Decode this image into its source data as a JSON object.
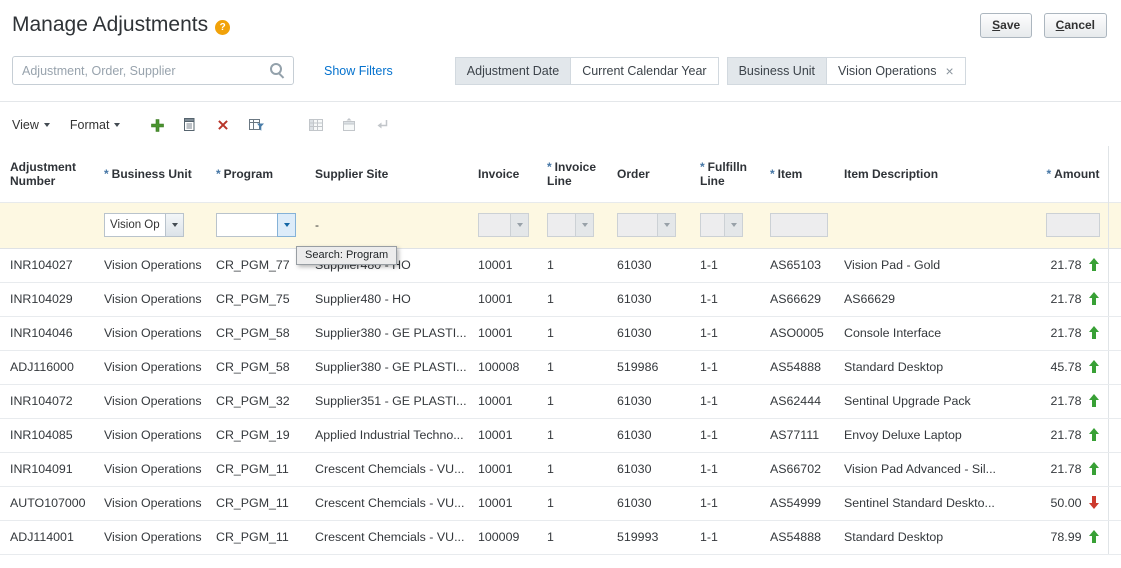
{
  "page": {
    "title": "Manage Adjustments",
    "help_glyph": "?"
  },
  "actions": {
    "save": "Save",
    "cancel": "Cancel"
  },
  "search": {
    "placeholder": "Adjustment, Order, Supplier",
    "show_filters": "Show Filters",
    "close_glyph": "×",
    "tokens": [
      {
        "label": "Adjustment Date",
        "value": "Current Calendar Year",
        "removable": false
      },
      {
        "label": "Business Unit",
        "value": "Vision Operations",
        "removable": true
      }
    ]
  },
  "toolbar": {
    "view": "View",
    "format": "Format"
  },
  "tooltip": {
    "text": "Search: Program"
  },
  "table": {
    "columns": [
      {
        "key": "adjustment_number",
        "label": "Adjustment Number",
        "required": false
      },
      {
        "key": "business_unit",
        "label": "Business Unit",
        "required": true
      },
      {
        "key": "program",
        "label": "Program",
        "required": true
      },
      {
        "key": "supplier_site",
        "label": "Supplier Site",
        "required": false
      },
      {
        "key": "invoice",
        "label": "Invoice",
        "required": false
      },
      {
        "key": "invoice_line",
        "label": "Invoice Line",
        "required": true
      },
      {
        "key": "order",
        "label": "Order",
        "required": false
      },
      {
        "key": "fulfill_line",
        "label": "Fulfilln Line",
        "required": true
      },
      {
        "key": "item",
        "label": "Item",
        "required": true
      },
      {
        "key": "item_description",
        "label": "Item Description",
        "required": false
      },
      {
        "key": "amount",
        "label": "Amount",
        "required": true,
        "align": "right"
      }
    ],
    "filter_row": {
      "business_unit": "Vision Oper",
      "program": "",
      "supplier_site": "-",
      "invoice": "",
      "invoice_line": "",
      "order": "",
      "fulfill_line": "",
      "item": "",
      "amount": ""
    },
    "rows": [
      {
        "adjustment_number": "INR104027",
        "business_unit": "Vision Operations",
        "program": "CR_PGM_77",
        "supplier_site": "Supplier480 - HO",
        "invoice": "10001",
        "invoice_line": "1",
        "order": "61030",
        "fulfill_line": "1-1",
        "item": "AS65103",
        "item_description": "Vision Pad - Gold",
        "amount": "21.78",
        "trend": "up"
      },
      {
        "adjustment_number": "INR104029",
        "business_unit": "Vision Operations",
        "program": "CR_PGM_75",
        "supplier_site": "Supplier480 - HO",
        "invoice": "10001",
        "invoice_line": "1",
        "order": "61030",
        "fulfill_line": "1-1",
        "item": "AS66629",
        "item_description": "AS66629",
        "amount": "21.78",
        "trend": "up"
      },
      {
        "adjustment_number": "INR104046",
        "business_unit": "Vision Operations",
        "program": "CR_PGM_58",
        "supplier_site": "Supplier380 - GE PLASTI...",
        "invoice": "10001",
        "invoice_line": "1",
        "order": "61030",
        "fulfill_line": "1-1",
        "item": "ASO0005",
        "item_description": "Console Interface",
        "amount": "21.78",
        "trend": "up"
      },
      {
        "adjustment_number": "ADJ116000",
        "business_unit": "Vision Operations",
        "program": "CR_PGM_58",
        "supplier_site": "Supplier380 - GE PLASTI...",
        "invoice": "100008",
        "invoice_line": "1",
        "order": "519986",
        "fulfill_line": "1-1",
        "item": "AS54888",
        "item_description": "Standard Desktop",
        "amount": "45.78",
        "trend": "up"
      },
      {
        "adjustment_number": "INR104072",
        "business_unit": "Vision Operations",
        "program": "CR_PGM_32",
        "supplier_site": "Supplier351 - GE PLASTI...",
        "invoice": "10001",
        "invoice_line": "1",
        "order": "61030",
        "fulfill_line": "1-1",
        "item": "AS62444",
        "item_description": "Sentinal Upgrade Pack",
        "amount": "21.78",
        "trend": "up"
      },
      {
        "adjustment_number": "INR104085",
        "business_unit": "Vision Operations",
        "program": "CR_PGM_19",
        "supplier_site": "Applied Industrial Techno...",
        "invoice": "10001",
        "invoice_line": "1",
        "order": "61030",
        "fulfill_line": "1-1",
        "item": "AS77111",
        "item_description": "Envoy Deluxe Laptop",
        "amount": "21.78",
        "trend": "up"
      },
      {
        "adjustment_number": "INR104091",
        "business_unit": "Vision Operations",
        "program": "CR_PGM_11",
        "supplier_site": "Crescent Chemcials - VU...",
        "invoice": "10001",
        "invoice_line": "1",
        "order": "61030",
        "fulfill_line": "1-1",
        "item": "AS66702",
        "item_description": "Vision Pad Advanced - Sil...",
        "amount": "21.78",
        "trend": "up"
      },
      {
        "adjustment_number": "AUTO107000",
        "business_unit": "Vision Operations",
        "program": "CR_PGM_11",
        "supplier_site": "Crescent Chemcials - VU...",
        "invoice": "10001",
        "invoice_line": "1",
        "order": "61030",
        "fulfill_line": "1-1",
        "item": "AS54999",
        "item_description": "Sentinel Standard Deskto...",
        "amount": "50.00",
        "trend": "down"
      },
      {
        "adjustment_number": "ADJ114001",
        "business_unit": "Vision Operations",
        "program": "CR_PGM_11",
        "supplier_site": "Crescent Chemcials - VU...",
        "invoice": "100009",
        "invoice_line": "1",
        "order": "519993",
        "fulfill_line": "1-1",
        "item": "AS54888",
        "item_description": "Standard Desktop",
        "amount": "78.99",
        "trend": "up"
      }
    ]
  }
}
